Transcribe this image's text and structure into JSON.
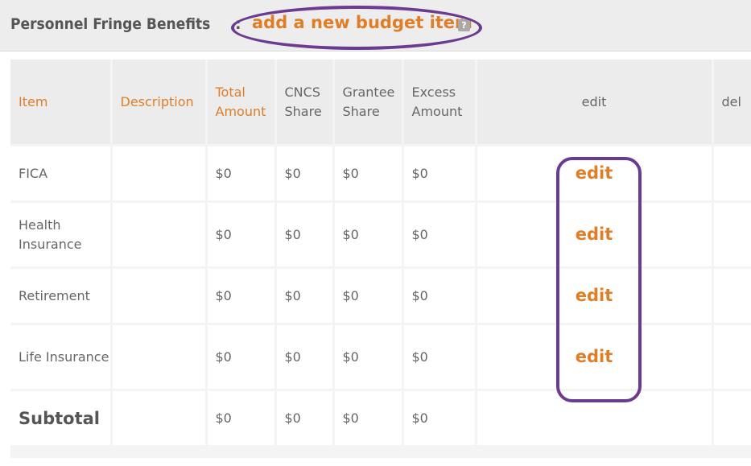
{
  "header": {
    "title": "Personnel Fringe Benefits",
    "separator": ":",
    "add_link": "add a new budget item",
    "help_icon": "?"
  },
  "table": {
    "columns": [
      "Item",
      "Description",
      "Total Amount",
      "CNCS Share",
      "Grantee Share",
      "Excess Amount",
      "edit",
      "del"
    ],
    "rows": [
      {
        "item": "FICA",
        "description": "",
        "total": "$0",
        "cncs": "$0",
        "grantee": "$0",
        "excess": "$0",
        "edit": "edit"
      },
      {
        "item": "Health Insurance",
        "description": "",
        "total": "$0",
        "cncs": "$0",
        "grantee": "$0",
        "excess": "$0",
        "edit": "edit"
      },
      {
        "item": "Retirement",
        "description": "",
        "total": "$0",
        "cncs": "$0",
        "grantee": "$0",
        "excess": "$0",
        "edit": "edit"
      },
      {
        "item": "Life Insurance",
        "description": "",
        "total": "$0",
        "cncs": "$0",
        "grantee": "$0",
        "excess": "$0",
        "edit": "edit"
      }
    ],
    "subtotal": {
      "label": "Subtotal",
      "total": "$0",
      "cncs": "$0",
      "grantee": "$0",
      "excess": "$0"
    }
  },
  "colors": {
    "accent": "#e07d27",
    "annotation": "#6b3a91",
    "header_bg": "#ececec"
  },
  "icons": {
    "help": "help-icon"
  }
}
